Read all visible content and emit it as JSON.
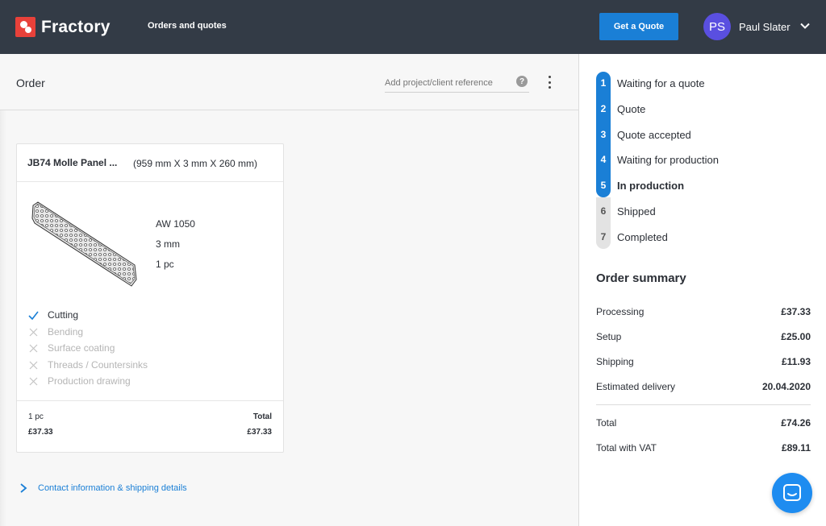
{
  "header": {
    "brand": "Fractory",
    "nav_link": "Orders and quotes",
    "quote_button": "Get a Quote",
    "user_initials": "PS",
    "user_name": "Paul Slater"
  },
  "order": {
    "title": "Order",
    "reference_placeholder": "Add project/client reference",
    "help_glyph": "?"
  },
  "part": {
    "name": "JB74 Molle Panel ...",
    "dimensions": "(959 mm X 3 mm X 260 mm)",
    "material": "AW 1050",
    "thickness": "3 mm",
    "quantity": "1 pc",
    "processes": [
      {
        "label": "Cutting",
        "enabled": true
      },
      {
        "label": "Bending",
        "enabled": false
      },
      {
        "label": "Surface coating",
        "enabled": false
      },
      {
        "label": "Threads / Countersinks",
        "enabled": false
      },
      {
        "label": "Production drawing",
        "enabled": false
      }
    ],
    "footer_qty": "1 pc",
    "footer_unit_price": "£37.33",
    "footer_total_label": "Total",
    "footer_total": "£37.33"
  },
  "contact_link": "Contact information & shipping details",
  "steps": [
    {
      "num": "1",
      "label": "Waiting for a quote",
      "state": "done"
    },
    {
      "num": "2",
      "label": "Quote",
      "state": "done"
    },
    {
      "num": "3",
      "label": "Quote accepted",
      "state": "done"
    },
    {
      "num": "4",
      "label": "Waiting for production",
      "state": "done"
    },
    {
      "num": "5",
      "label": "In production",
      "state": "current"
    },
    {
      "num": "6",
      "label": "Shipped",
      "state": "todo"
    },
    {
      "num": "7",
      "label": "Completed",
      "state": "todo"
    }
  ],
  "summary": {
    "title": "Order summary",
    "rows": [
      {
        "label": "Processing",
        "value": "£37.33"
      },
      {
        "label": "Setup",
        "value": "£25.00"
      },
      {
        "label": "Shipping",
        "value": "£11.93"
      },
      {
        "label": "Estimated delivery",
        "value": "20.04.2020"
      }
    ],
    "totals": [
      {
        "label": "Total",
        "value": "£74.26"
      },
      {
        "label": "Total with VAT",
        "value": "£89.11"
      }
    ]
  },
  "colors": {
    "topbar": "#333b46",
    "accent": "#1a7fd6",
    "brand_red": "#e8413a",
    "avatar": "#5a4fe0"
  }
}
